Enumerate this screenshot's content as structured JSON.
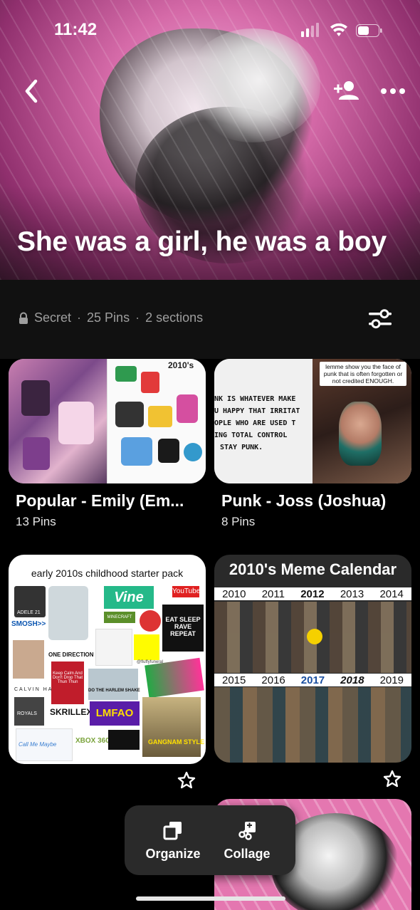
{
  "status": {
    "time": "11:42"
  },
  "board": {
    "title": "She was a girl, he was a boy"
  },
  "info": {
    "privacy": "Secret",
    "pins": "25 Pins",
    "sections": "2 sections"
  },
  "sections": [
    {
      "title": "Popular - Emily (Em...",
      "count": "13 Pins"
    },
    {
      "title": "Punk - Joss (Joshua)",
      "count": "8 Pins"
    }
  ],
  "section_thumbs": {
    "emily_right_label": "2010's",
    "punk_caption": "lemme show you the face of punk that is often forgotten or not credited ENOUGH.",
    "punk_lines": [
      "NK IS WHATEVER MAKE",
      "U HAPPY THAT IRRITAT",
      "OPLE WHO ARE USED T",
      "ING TOTAL CONTROL",
      "STAY PUNK."
    ]
  },
  "pins": [
    {
      "title": "early 2010s childhood starter pack",
      "labels": [
        "Vine",
        "YouTube",
        "SMOSH>>",
        "ONE DIRECTION",
        "EAT SLEEP RAVE REPEAT",
        "Keep Calm And Don't Drop That Thun Thun",
        "DO THE HARLEM SHAKE",
        "LMFAO",
        "SKRILLEX",
        "XBOX 360",
        "ROYALS",
        "CALVIN HARRIS",
        "Call Me Maybe",
        "GANGNAM STYLE",
        "ADELE 21",
        "MINECRAFT",
        "@fluffyfuneral"
      ]
    },
    {
      "title": "2010's Meme Calendar",
      "years_top": [
        "2010",
        "2011",
        "2012",
        "2013",
        "2014"
      ],
      "years_bottom": [
        "2015",
        "2016",
        "2017",
        "2018",
        "2019"
      ]
    }
  ],
  "actions": {
    "organize": "Organize",
    "collage": "Collage"
  },
  "colors": {
    "cover_pink": "#d56aa8",
    "info_bg": "#111111",
    "action_bg": "#2a2a2a"
  }
}
